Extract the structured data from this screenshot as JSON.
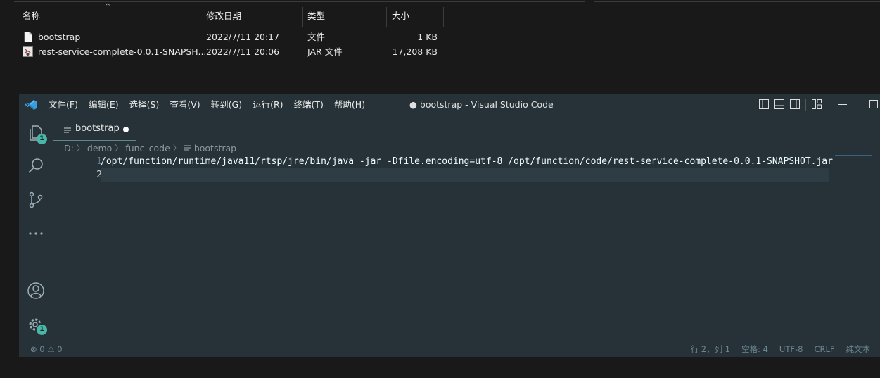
{
  "explorer": {
    "columns": {
      "name": "名称",
      "date": "修改日期",
      "type": "类型",
      "size": "大小"
    },
    "files": [
      {
        "name": "bootstrap",
        "date": "2022/7/11 20:17",
        "type": "文件",
        "size": "1 KB",
        "icon": "file-icon"
      },
      {
        "name": "rest-service-complete-0.0.1-SNAPSH...",
        "date": "2022/7/11 20:06",
        "type": "JAR 文件",
        "size": "17,208 KB",
        "icon": "jar-file-icon"
      }
    ]
  },
  "vscode": {
    "menu": [
      "文件(F)",
      "编辑(E)",
      "选择(S)",
      "查看(V)",
      "转到(G)",
      "运行(R)",
      "终端(T)",
      "帮助(H)"
    ],
    "window_title": "● bootstrap - Visual Studio Code",
    "activity_badges": {
      "explorer": "1",
      "settings": "1"
    },
    "tab": {
      "label": "bootstrap"
    },
    "breadcrumb": [
      "D:",
      "demo",
      "func_code",
      "bootstrap"
    ],
    "lines": [
      {
        "no": "1",
        "text": "/opt/function/runtime/java11/rtsp/jre/bin/java -jar -Dfile.encoding=utf-8 /opt/function/code/rest-service-complete-0.0.1-SNAPSHOT.jar"
      },
      {
        "no": "2",
        "text": ""
      }
    ],
    "status": {
      "problems": "⊗ 0 ⚠ 0",
      "position": "行 2，列 1",
      "spaces": "空格: 4",
      "encoding": "UTF-8",
      "eol": "CRLF",
      "language": "纯文本"
    }
  },
  "colors": {
    "editor_bg": "#263238",
    "badge": "#4ab6a6",
    "desktop_bg": "#191919"
  }
}
